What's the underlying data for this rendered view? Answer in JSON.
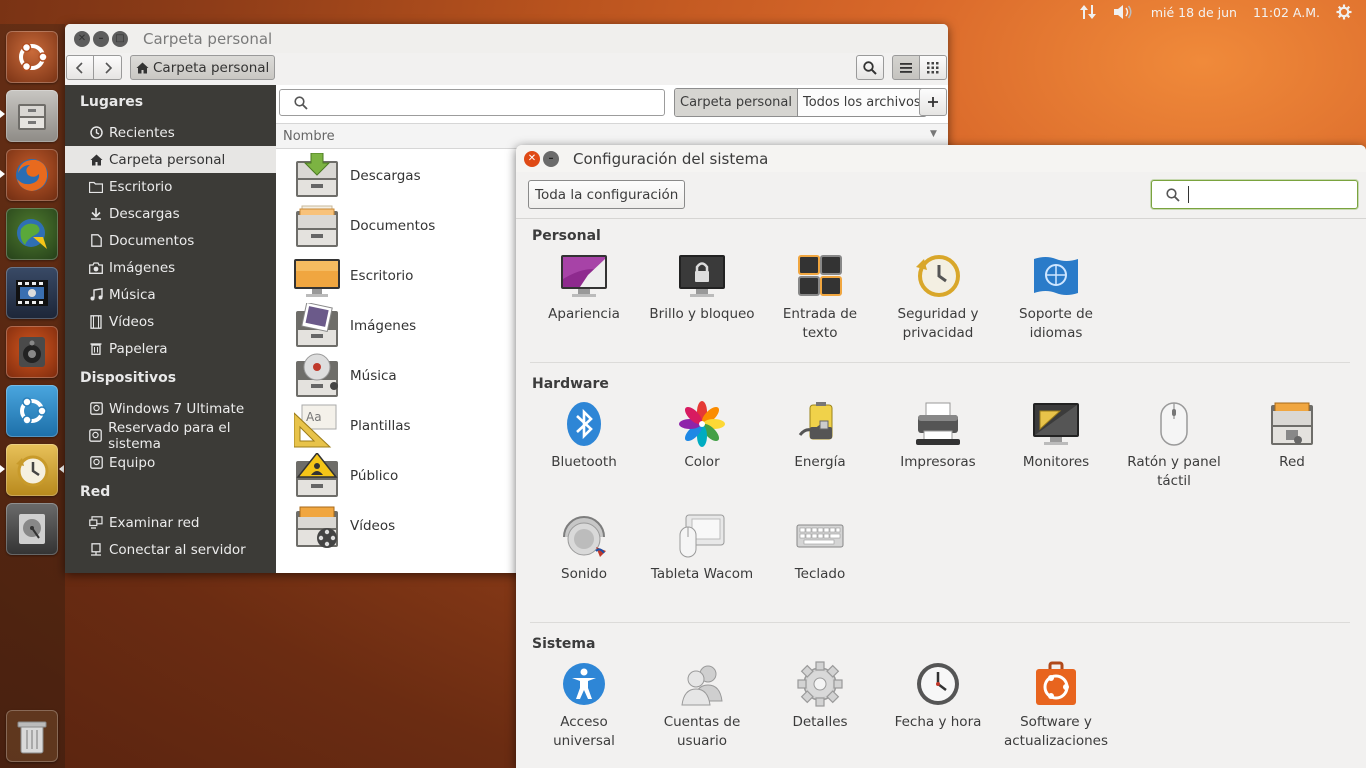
{
  "top_panel": {
    "date": "mié 18 de jun",
    "time": "11:02 A.M."
  },
  "file_manager": {
    "title": "Carpeta personal",
    "location": "Carpeta personal",
    "scope_home": "Carpeta personal",
    "scope_all": "Todos los archivos",
    "search_placeholder": "",
    "column_header": "Nombre",
    "sidebar": {
      "places_header": "Lugares",
      "places": [
        "Recientes",
        "Carpeta personal",
        "Escritorio",
        "Descargas",
        "Documentos",
        "Imágenes",
        "Música",
        "Vídeos",
        "Papelera"
      ],
      "devices_header": "Dispositivos",
      "devices": [
        "Windows 7 Ultimate",
        "Reservado para el sistema",
        "Equipo"
      ],
      "network_header": "Red",
      "network": [
        "Examinar red",
        "Conectar al servidor"
      ]
    },
    "files": [
      "Descargas",
      "Documentos",
      "Escritorio",
      "Imágenes",
      "Música",
      "Plantillas",
      "Público",
      "Vídeos"
    ]
  },
  "settings": {
    "title": "Configuración del sistema",
    "all_settings_label": "Toda la configuración",
    "search_value": "",
    "sections": {
      "personal": "Personal",
      "hardware": "Hardware",
      "system": "Sistema"
    },
    "personal_items": [
      {
        "l1": "Apariencia",
        "l2": ""
      },
      {
        "l1": "Brillo y bloqueo",
        "l2": ""
      },
      {
        "l1": "Entrada de",
        "l2": "texto"
      },
      {
        "l1": "Seguridad y",
        "l2": "privacidad"
      },
      {
        "l1": "Soporte de",
        "l2": "idiomas"
      }
    ],
    "hardware_items": [
      {
        "l1": "Bluetooth",
        "l2": ""
      },
      {
        "l1": "Color",
        "l2": ""
      },
      {
        "l1": "Energía",
        "l2": ""
      },
      {
        "l1": "Impresoras",
        "l2": ""
      },
      {
        "l1": "Monitores",
        "l2": ""
      },
      {
        "l1": "Ratón y panel",
        "l2": "táctil"
      },
      {
        "l1": "Red",
        "l2": ""
      },
      {
        "l1": "Sonido",
        "l2": ""
      },
      {
        "l1": "Tableta Wacom",
        "l2": ""
      },
      {
        "l1": "Teclado",
        "l2": ""
      }
    ],
    "system_items": [
      {
        "l1": "Acceso",
        "l2": "universal"
      },
      {
        "l1": "Cuentas de",
        "l2": "usuario"
      },
      {
        "l1": "Detalles",
        "l2": ""
      },
      {
        "l1": "Fecha y hora",
        "l2": ""
      },
      {
        "l1": "Software y",
        "l2": "actualizaciones"
      }
    ]
  },
  "colors": {
    "accent": "#dd4814",
    "sidebar_bg": "#3c3b37",
    "launcher_bg": "#5a2c14",
    "close_button": "#df4a16"
  },
  "icons": {
    "launcher": [
      "ubuntu-dash-icon",
      "files-icon",
      "firefox-icon",
      "mail-icon",
      "video-player-icon",
      "music-player-icon",
      "software-center-icon",
      "backup-icon",
      "disk-icon",
      "trash-icon"
    ]
  }
}
